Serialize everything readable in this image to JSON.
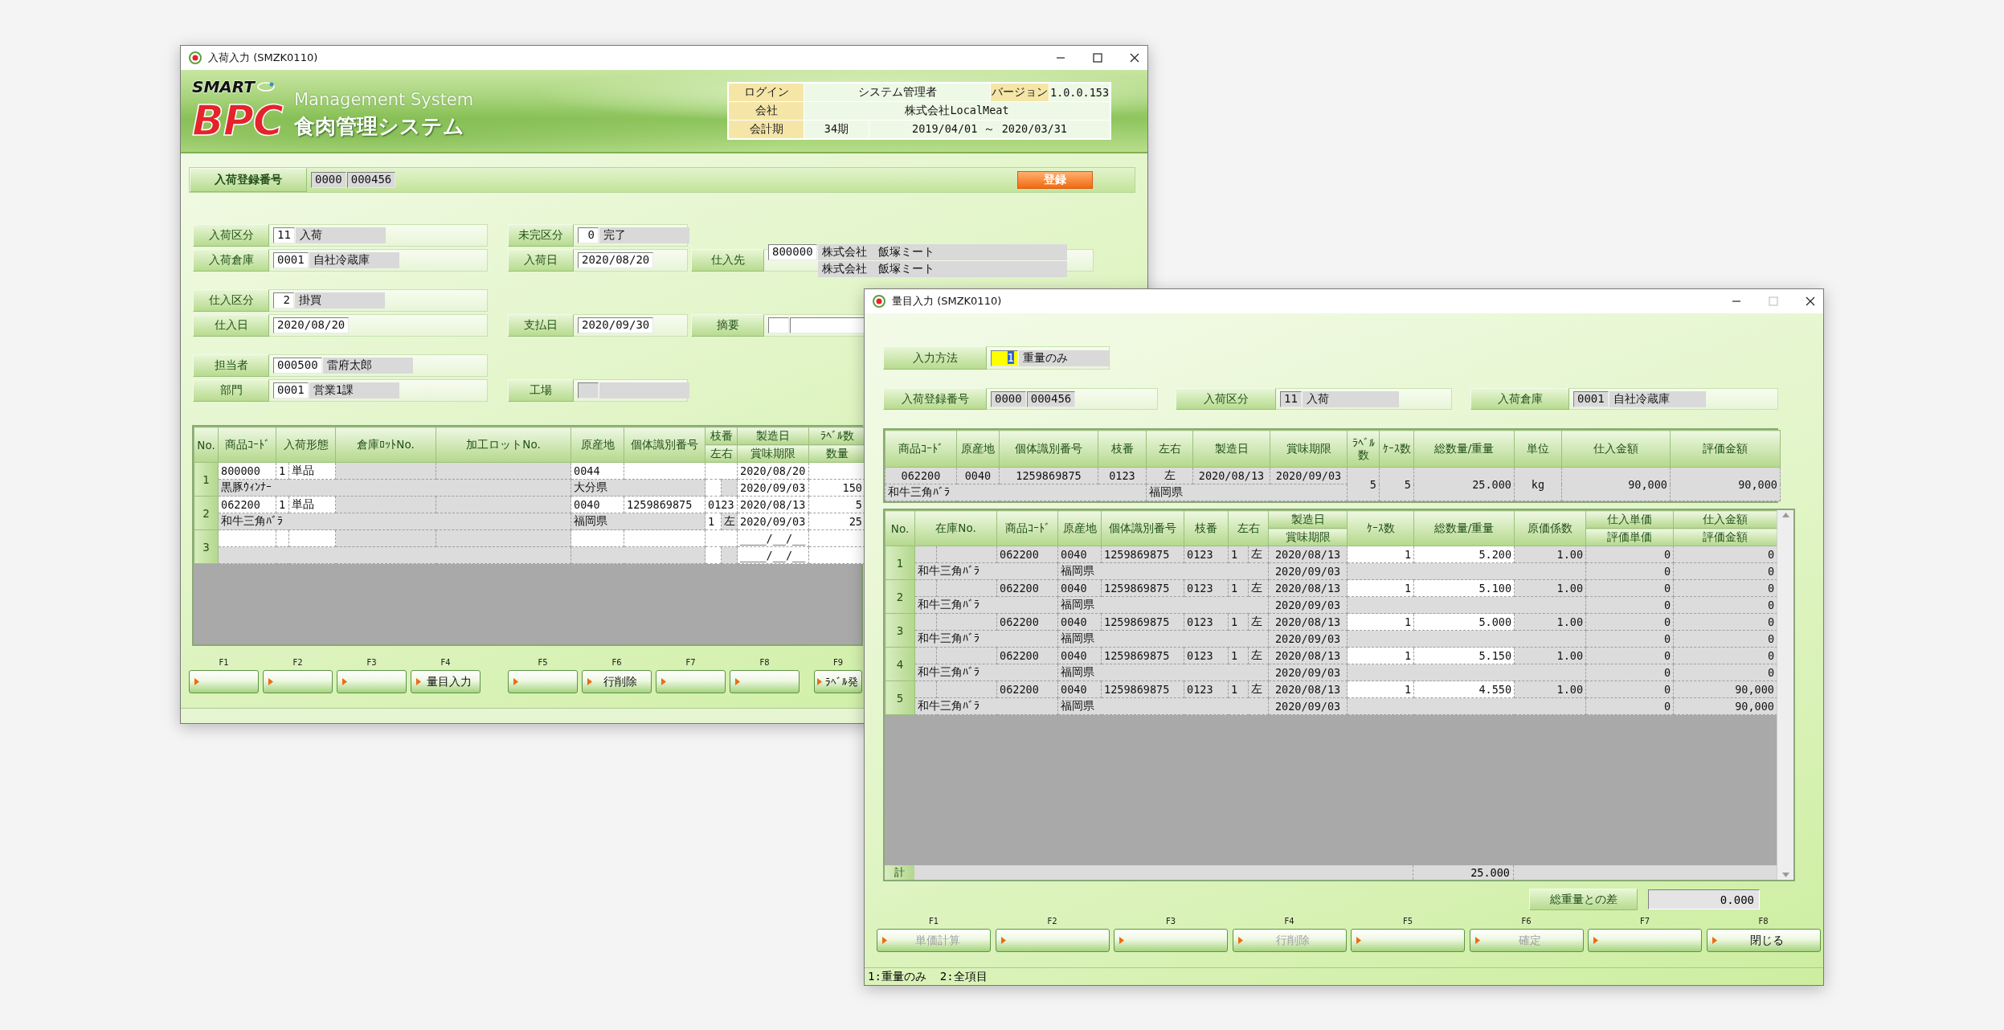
{
  "main_window": {
    "title": "入荷入力 (SMZK0110)",
    "maximize_enabled": true,
    "header": {
      "logo_top": "SMART",
      "logo_main": "BPC",
      "tagline": "Management System",
      "system_name": "食肉管理システム",
      "login_label": "ログイン",
      "login_user": "システム管理者",
      "version_label": "バージョン",
      "version": "1.0.0.153",
      "company_label": "会社",
      "company": "株式会社LocalMeat",
      "period_label": "会計期",
      "period": "34期",
      "period_range": "2019/04/01 ～ 2020/03/31"
    },
    "registration": {
      "label": "入荷登録番号",
      "fields": [
        {
          "kind": "locked",
          "value": "0000"
        },
        {
          "kind": "locked",
          "value": "000456"
        }
      ],
      "button": "登録"
    },
    "form_blocks": [
      {
        "left": [
          {
            "label": "入荷区分",
            "lines": [
              [
                {
                  "kind": "code",
                  "value": "11"
                },
                {
                  "kind": "name",
                  "value": "入荷"
                }
              ]
            ]
          },
          {
            "label": "入荷倉庫",
            "lines": [
              [
                {
                  "kind": "code",
                  "value": "0001"
                },
                {
                  "kind": "name",
                  "value": "自社冷蔵庫"
                }
              ]
            ]
          }
        ],
        "middle": [
          {
            "label": "未完区分",
            "lines": [
              [
                {
                  "kind": "code",
                  "value": "0"
                },
                {
                  "kind": "name",
                  "value": "完了"
                }
              ]
            ]
          },
          {
            "label": "入荷日",
            "lines": [
              [
                {
                  "kind": "date",
                  "value": "2020/08/20"
                }
              ]
            ]
          }
        ],
        "right": [
          {
            "label": "仕入先",
            "lines": [
              [
                {
                  "kind": "code",
                  "value": "800000"
                },
                {
                  "kind": "name",
                  "value": "株式会社　飯塚ミート"
                }
              ],
              [
                {
                  "kind": "name",
                  "value": "株式会社　飯塚ミート"
                }
              ]
            ]
          }
        ]
      },
      {
        "left": [
          {
            "label": "仕入区分",
            "lines": [
              [
                {
                  "kind": "code",
                  "value": "2"
                },
                {
                  "kind": "name",
                  "value": "掛買"
                }
              ]
            ]
          },
          {
            "label": "仕入日",
            "lines": [
              [
                {
                  "kind": "date",
                  "value": "2020/08/20"
                }
              ]
            ]
          }
        ],
        "middle": [
          {
            "label": "支払日",
            "lines": [
              [
                {
                  "kind": "date",
                  "value": "2020/09/30"
                }
              ]
            ]
          }
        ],
        "right": [
          {
            "label": "摘要",
            "lines": [
              [
                {
                  "kind": "code"
                },
                {
                  "kind": "date"
                }
              ]
            ]
          }
        ]
      },
      {
        "left": [
          {
            "label": "担当者",
            "lines": [
              [
                {
                  "kind": "code",
                  "value": "000500"
                },
                {
                  "kind": "name",
                  "value": "雷府太郎"
                }
              ]
            ]
          },
          {
            "label": "部門",
            "lines": [
              [
                {
                  "kind": "code",
                  "value": "0001"
                },
                {
                  "kind": "name",
                  "value": "営業1課"
                }
              ]
            ]
          }
        ],
        "middle": [
          {
            "label": "工場",
            "lines": [
              [
                {
                  "kind": "locked"
                },
                {
                  "kind": "name"
                }
              ]
            ]
          }
        ]
      }
    ],
    "table": {
      "header_top": [
        "No.",
        "商品ｺｰﾄﾞ",
        "入荷形態",
        "倉庫ﾛｯﾄNo.",
        "加工ロットNo.",
        "原産地",
        "個体識別番号",
        "枝番",
        "製造日",
        "ﾗﾍﾞﾙ数"
      ],
      "header_bottom": [
        "左右",
        "賞味期限",
        "数量"
      ],
      "rows": [
        {
          "number": "1",
          "code": "800000",
          "form_code": "1",
          "form_name": "単品",
          "origin_code": "0044",
          "manufactured": "2020/08/20",
          "product_name": "黒豚ｳｨﾝﾅｰ",
          "origin_name": "大分県",
          "expiry": "2020/09/03",
          "quantity": "150"
        },
        {
          "number": "2",
          "code": "062200",
          "form_code": "1",
          "form_name": "単品",
          "origin_code": "0040",
          "individual_id": "1259869875",
          "branch": "0123",
          "manufactured": "2020/08/13",
          "label_count": "5",
          "product_name": "和牛三角ﾊﾞﾗ",
          "origin_name": "福岡県",
          "branch_no": "1",
          "side": "左",
          "expiry": "2020/09/03",
          "quantity": "25"
        },
        {
          "number": "3",
          "manufactured": "____/__/__",
          "expiry": "____/__/__"
        }
      ]
    },
    "function_keys": [
      {
        "key": "F1"
      },
      {
        "key": "F2"
      },
      {
        "key": "F3"
      },
      {
        "key": "F4",
        "label": "量目入力"
      },
      {
        "key": "F5"
      },
      {
        "key": "F6",
        "label": "行削除"
      },
      {
        "key": "F7"
      },
      {
        "key": "F8"
      },
      {
        "key": "F9",
        "label": "ﾗﾍﾞﾙ発"
      }
    ]
  },
  "dialog": {
    "title": "量目入力 (SMZK0110)",
    "maximize_enabled": false,
    "input_method": {
      "label": "入力方法",
      "code": "1",
      "name": "重量のみ"
    },
    "info": [
      {
        "label": "入荷登録番号",
        "fields": [
          {
            "kind": "locked",
            "value": "0000"
          },
          {
            "kind": "locked",
            "value": "000456"
          }
        ]
      },
      {
        "label": "入荷区分",
        "fields": [
          {
            "kind": "locked",
            "value": "11"
          },
          {
            "kind": "name",
            "value": "入荷"
          }
        ]
      },
      {
        "label": "入荷倉庫",
        "fields": [
          {
            "kind": "locked",
            "value": "0001"
          },
          {
            "kind": "name",
            "value": "自社冷蔵庫"
          }
        ]
      }
    ],
    "summary": {
      "columns": [
        "商品ｺｰﾄﾞ",
        "原産地",
        "個体識別番号",
        "枝番",
        "左右",
        "製造日",
        "賞味期限",
        "ﾗﾍﾞﾙ数",
        "ｹｰｽ数",
        "総数量/重量",
        "単位",
        "仕入金額",
        "評価金額"
      ],
      "row": {
        "code": "062200",
        "origin_code": "0040",
        "individual_id": "1259869875",
        "branch": "0123",
        "side": "左",
        "manufactured": "2020/08/13",
        "expiry": "2020/09/03",
        "label_count": "5",
        "case_count": "5",
        "total_weight": "25.000",
        "unit": "kg",
        "purchase_amount": "90,000",
        "valuation_amount": "90,000",
        "product_name": "和牛三角ﾊﾞﾗ",
        "origin_name": "福岡県"
      }
    },
    "detail": {
      "header_top": [
        "No.",
        "在庫No.",
        "商品ｺｰﾄﾞ",
        "原産地",
        "個体識別番号",
        "枝番",
        "左右",
        "製造日",
        "ｹｰｽ数",
        "総数量/重量",
        "原価係数",
        "仕入単価",
        "仕入金額"
      ],
      "header_bottom": [
        "賞味期限",
        "評価単価",
        "評価金額"
      ],
      "rows": [
        {
          "number": "1",
          "code": "062200",
          "origin_code": "0040",
          "individual_id": "1259869875",
          "branch": "0123",
          "branch_no": "1",
          "side": "左",
          "manufactured": "2020/08/13",
          "case_count": "1",
          "weight": "5.200",
          "cost_factor": "1.00",
          "unit_price": "0",
          "amount": "0",
          "product_name": "和牛三角ﾊﾞﾗ",
          "origin_name": "福岡県",
          "expiry": "2020/09/03",
          "valuation_unit_price": "0",
          "valuation_amount": "0"
        },
        {
          "number": "2",
          "code": "062200",
          "origin_code": "0040",
          "individual_id": "1259869875",
          "branch": "0123",
          "branch_no": "1",
          "side": "左",
          "manufactured": "2020/08/13",
          "case_count": "1",
          "weight": "5.100",
          "cost_factor": "1.00",
          "unit_price": "0",
          "amount": "0",
          "product_name": "和牛三角ﾊﾞﾗ",
          "origin_name": "福岡県",
          "expiry": "2020/09/03",
          "valuation_unit_price": "0",
          "valuation_amount": "0"
        },
        {
          "number": "3",
          "code": "062200",
          "origin_code": "0040",
          "individual_id": "1259869875",
          "branch": "0123",
          "branch_no": "1",
          "side": "左",
          "manufactured": "2020/08/13",
          "case_count": "1",
          "weight": "5.000",
          "cost_factor": "1.00",
          "unit_price": "0",
          "amount": "0",
          "product_name": "和牛三角ﾊﾞﾗ",
          "origin_name": "福岡県",
          "expiry": "2020/09/03",
          "valuation_unit_price": "0",
          "valuation_amount": "0"
        },
        {
          "number": "4",
          "code": "062200",
          "origin_code": "0040",
          "individual_id": "1259869875",
          "branch": "0123",
          "branch_no": "1",
          "side": "左",
          "manufactured": "2020/08/13",
          "case_count": "1",
          "weight": "5.150",
          "cost_factor": "1.00",
          "unit_price": "0",
          "amount": "0",
          "product_name": "和牛三角ﾊﾞﾗ",
          "origin_name": "福岡県",
          "expiry": "2020/09/03",
          "valuation_unit_price": "0",
          "valuation_amount": "0"
        },
        {
          "number": "5",
          "code": "062200",
          "origin_code": "0040",
          "individual_id": "1259869875",
          "branch": "0123",
          "branch_no": "1",
          "side": "左",
          "manufactured": "2020/08/13",
          "case_count": "1",
          "weight": "4.550",
          "cost_factor": "1.00",
          "unit_price": "0",
          "amount": "90,000",
          "product_name": "和牛三角ﾊﾞﾗ",
          "origin_name": "福岡県",
          "expiry": "2020/09/03",
          "valuation_unit_price": "0",
          "valuation_amount": "90,000"
        }
      ],
      "total_label": "計",
      "total_weight": "25.000"
    },
    "difference": {
      "label": "総重量との差",
      "value": "0.000"
    },
    "function_keys": [
      {
        "key": "F1",
        "label": "単価計算",
        "disabled": true
      },
      {
        "key": "F2"
      },
      {
        "key": "F3"
      },
      {
        "key": "F4",
        "label": "行削除",
        "disabled": true
      },
      {
        "key": "F5"
      },
      {
        "key": "F6",
        "label": "確定",
        "disabled": true
      },
      {
        "key": "F7"
      },
      {
        "key": "F8",
        "label": "閉じる",
        "disabled": false
      }
    ],
    "status": "1:重量のみ  2:全項目"
  }
}
